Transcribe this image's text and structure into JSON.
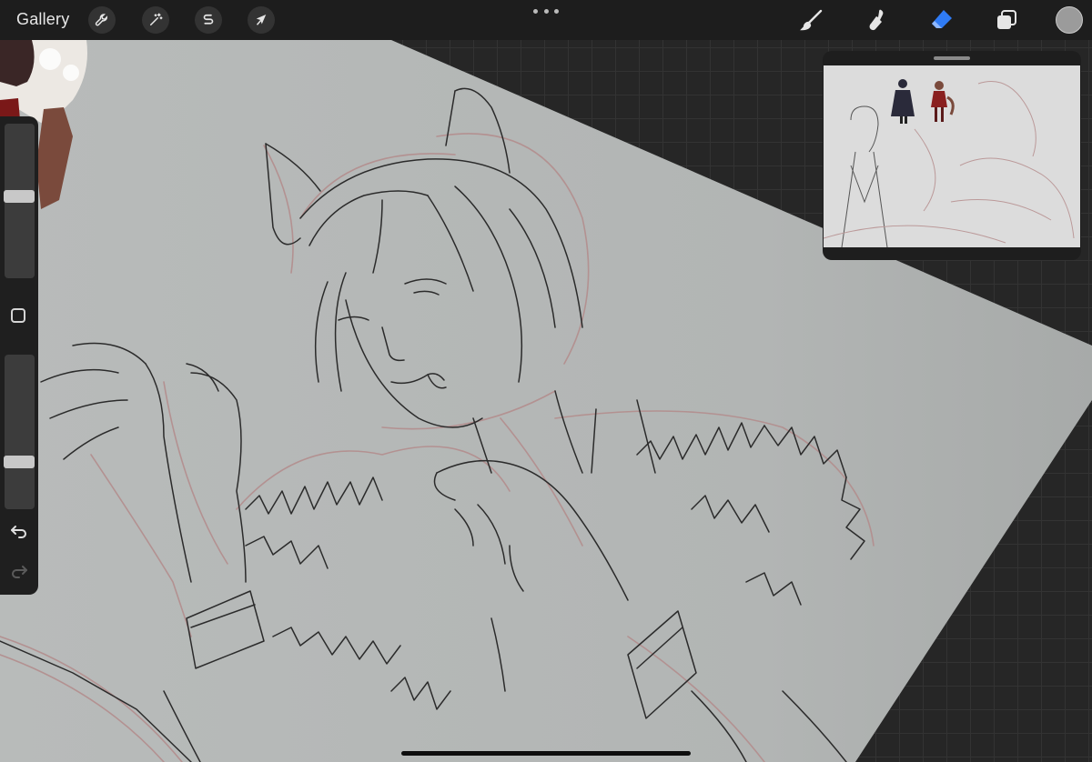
{
  "topbar": {
    "gallery_label": "Gallery",
    "left_tools": [
      {
        "name": "actions",
        "icon": "wrench-icon"
      },
      {
        "name": "adjustments",
        "icon": "magic-wand-icon"
      },
      {
        "name": "selection",
        "icon": "selection-s-icon"
      },
      {
        "name": "transform",
        "icon": "arrow-cursor-icon"
      }
    ],
    "more_icon": "more-dots-icon",
    "right_tools": [
      {
        "name": "brush",
        "icon": "brush-icon",
        "active": false
      },
      {
        "name": "smudge",
        "icon": "smudge-finger-icon",
        "active": false
      },
      {
        "name": "eraser",
        "icon": "eraser-icon",
        "active": true
      },
      {
        "name": "layers",
        "icon": "layers-icon",
        "active": false
      }
    ],
    "current_color": "#9b9b9b",
    "active_tool_color": "#2f7bf5"
  },
  "sidebar": {
    "brush_size_level": 0.53,
    "opacity_level": 0.29,
    "modify_icon": "square-modify-icon",
    "undo_icon": "undo-arrow-icon",
    "redo_icon": "redo-arrow-icon",
    "redo_enabled": false
  },
  "reference_window": {
    "icon": "drag-handle-icon"
  },
  "colors": {
    "canvas_paper": "#b6b9b8",
    "sketch_line": "#2b2b2b",
    "sketch_red": "#b38d8d",
    "ui_dark": "#1d1d1d"
  }
}
